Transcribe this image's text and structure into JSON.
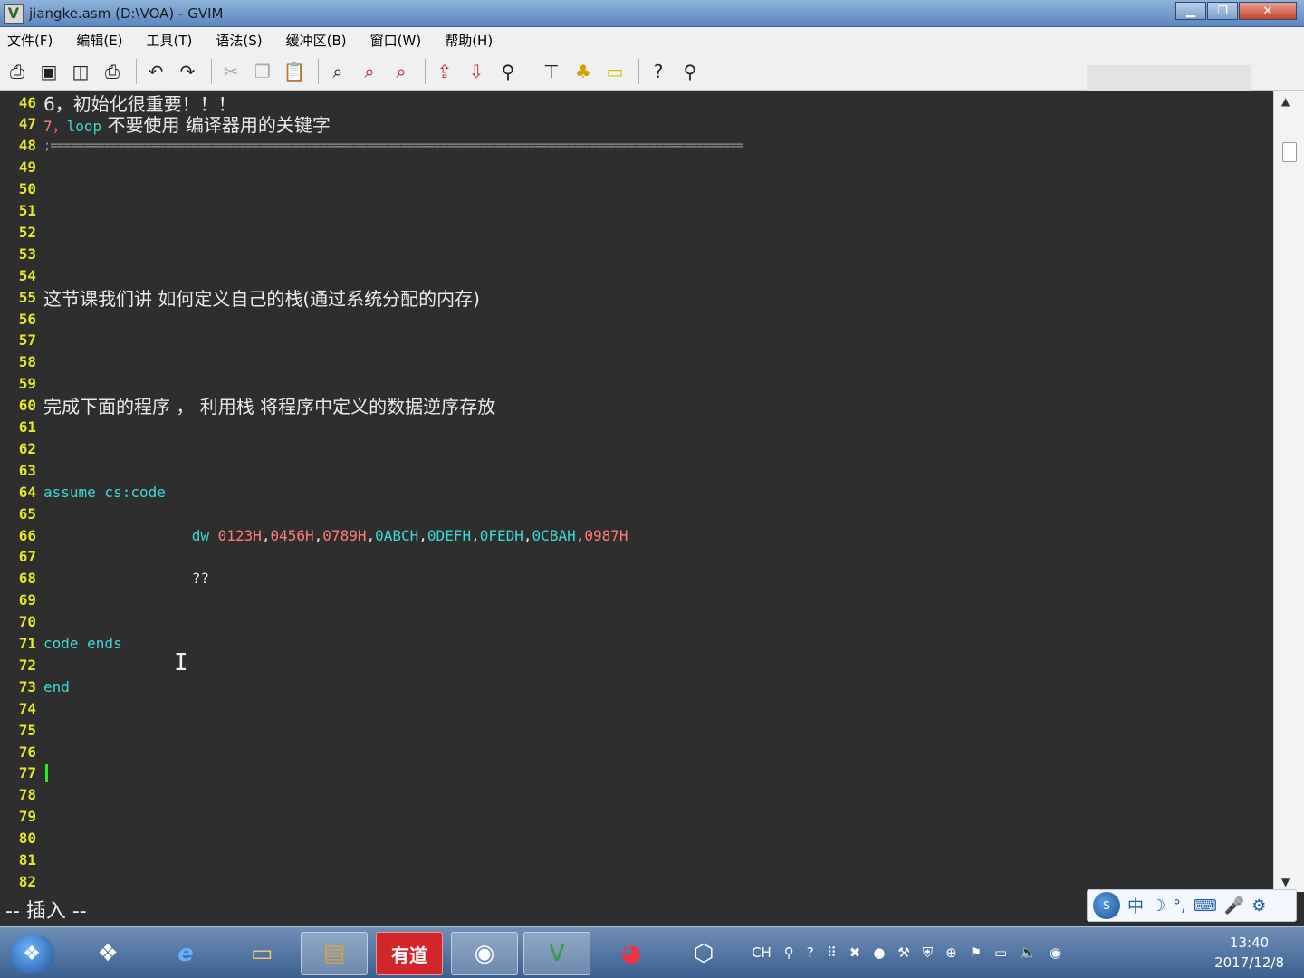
{
  "window": {
    "title": "jiangke.asm (D:\\VOA) - GVIM",
    "app_icon": "gvim-icon",
    "controls": [
      "minimize",
      "maximize",
      "close"
    ]
  },
  "menu": [
    {
      "label": "文件(F)"
    },
    {
      "label": "编辑(E)"
    },
    {
      "label": "工具(T)"
    },
    {
      "label": "语法(S)"
    },
    {
      "label": "缓冲区(B)"
    },
    {
      "label": "窗口(W)"
    },
    {
      "label": "帮助(H)"
    }
  ],
  "toolbar": [
    "open-icon",
    "save-icon",
    "save-all-icon",
    "print-icon",
    "undo-icon",
    "redo-icon",
    "cut-icon",
    "copy-icon",
    "paste-icon",
    "find-replace-icon",
    "find-next-icon",
    "find-prev-icon",
    "load-session-icon",
    "save-session-icon",
    "run-script-icon",
    "make-icon",
    "shell-icon",
    "tags-icon",
    "help-icon",
    "find-help-icon"
  ],
  "editor": {
    "lines": [
      {
        "n": "46",
        "text": "6，初始化很重要！！！",
        "type": "zh"
      },
      {
        "n": "47",
        "parts": [
          {
            "t": "7，",
            "c": "num"
          },
          {
            "t": "loop",
            "c": "kw"
          },
          {
            "t": " 不要使用 编译器用的关键字",
            "c": "zh"
          }
        ]
      },
      {
        "n": "48",
        "text": ";=======================================================================================================",
        "type": "sep"
      },
      {
        "n": "49"
      },
      {
        "n": "50"
      },
      {
        "n": "51"
      },
      {
        "n": "52"
      },
      {
        "n": "53"
      },
      {
        "n": "54"
      },
      {
        "n": "55",
        "text": "这节课我们讲 如何定义自己的栈(通过系统分配的内存)",
        "type": "zh"
      },
      {
        "n": "56"
      },
      {
        "n": "57"
      },
      {
        "n": "58"
      },
      {
        "n": "59"
      },
      {
        "n": "60",
        "text": "完成下面的程序 ， 利用栈 将程序中定义的数据逆序存放",
        "type": "zh"
      },
      {
        "n": "61"
      },
      {
        "n": "62"
      },
      {
        "n": "63"
      },
      {
        "n": "64",
        "parts": [
          {
            "t": "assume cs:code",
            "c": "kw"
          }
        ]
      },
      {
        "n": "65"
      },
      {
        "n": "66",
        "parts": [
          {
            "t": "                 "
          },
          {
            "t": "dw",
            "c": "kw"
          },
          {
            "t": " "
          },
          {
            "t": "0123H",
            "c": "num"
          },
          {
            "t": ","
          },
          {
            "t": "0456H",
            "c": "num"
          },
          {
            "t": ","
          },
          {
            "t": "0789H",
            "c": "num"
          },
          {
            "t": ","
          },
          {
            "t": "0ABCH",
            "c": "kw"
          },
          {
            "t": ","
          },
          {
            "t": "0DEFH",
            "c": "kw"
          },
          {
            "t": ","
          },
          {
            "t": "0FEDH",
            "c": "kw"
          },
          {
            "t": ","
          },
          {
            "t": "0CBAH",
            "c": "kw"
          },
          {
            "t": ","
          },
          {
            "t": "0987H",
            "c": "num"
          }
        ]
      },
      {
        "n": "67"
      },
      {
        "n": "68",
        "parts": [
          {
            "t": "                 ??"
          }
        ]
      },
      {
        "n": "69"
      },
      {
        "n": "70"
      },
      {
        "n": "71",
        "parts": [
          {
            "t": "code ends",
            "c": "kw"
          }
        ]
      },
      {
        "n": "72"
      },
      {
        "n": "73",
        "parts": [
          {
            "t": "end",
            "c": "kw"
          }
        ]
      },
      {
        "n": "74"
      },
      {
        "n": "75"
      },
      {
        "n": "76"
      },
      {
        "n": "77",
        "cursor": true
      },
      {
        "n": "78"
      },
      {
        "n": "79"
      },
      {
        "n": "80"
      },
      {
        "n": "81"
      },
      {
        "n": "82"
      }
    ]
  },
  "status": {
    "mode": "-- 插入 --"
  },
  "ime": {
    "items": [
      "中",
      "☽",
      "°,",
      "⌨",
      "🎤",
      "⚙"
    ]
  },
  "taskbar": {
    "apps": [
      {
        "name": "start-button",
        "icon": "windows-icon"
      },
      {
        "name": "taskbar-app-1",
        "icon": "apps-icon"
      },
      {
        "name": "taskbar-ie",
        "icon": "ie-icon",
        "glyph": "e"
      },
      {
        "name": "taskbar-explorer",
        "icon": "folder-icon"
      },
      {
        "name": "taskbar-app-4",
        "icon": "book-icon"
      },
      {
        "name": "taskbar-youdao",
        "icon": "youdao-icon",
        "glyph": "有道"
      },
      {
        "name": "taskbar-app-6",
        "icon": "camera-icon"
      },
      {
        "name": "taskbar-gvim",
        "icon": "gvim-icon",
        "active": true
      },
      {
        "name": "taskbar-chrome",
        "icon": "chrome-icon"
      },
      {
        "name": "taskbar-vbox",
        "icon": "box-icon"
      }
    ],
    "tray_lang": "CH",
    "time": "13:40",
    "date": "2017/12/8"
  }
}
